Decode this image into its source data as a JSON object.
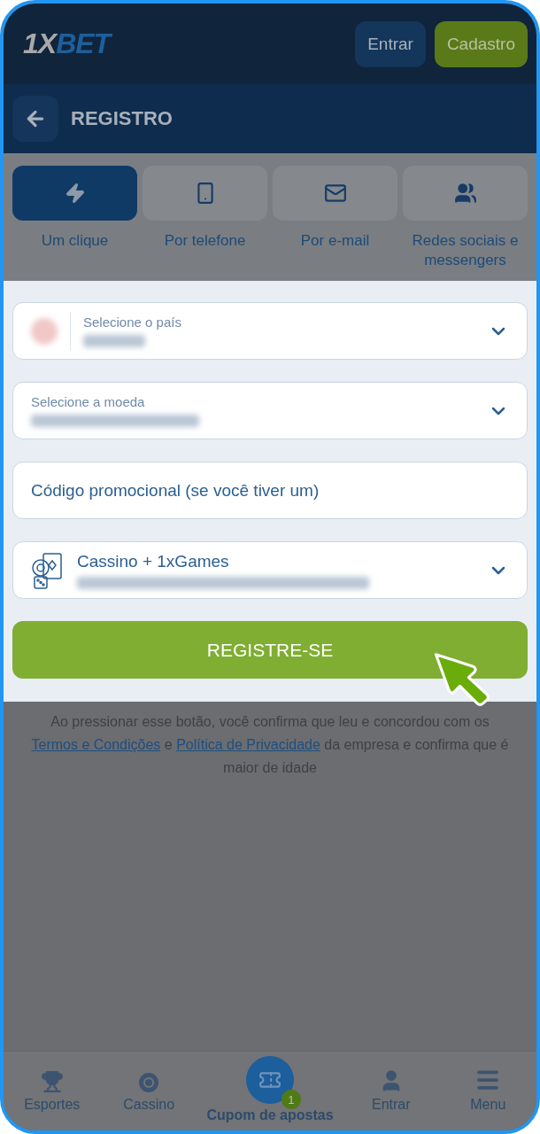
{
  "header": {
    "logo": {
      "part_1": "1X",
      "part_2": "BET"
    },
    "buttons": [
      {
        "label": "Entrar",
        "kind": "secondary"
      },
      {
        "label": "Cadastro",
        "kind": "primary"
      }
    ]
  },
  "page_title": "REGISTRO",
  "tabs": [
    {
      "label": "Um clique",
      "selected": true
    },
    {
      "label": "Por telefone",
      "selected": false
    },
    {
      "label": "Por e-mail",
      "selected": false
    },
    {
      "label": "Redes sociais e messengers",
      "selected": false
    }
  ],
  "fields": [
    {
      "kind": "flag_select",
      "label": "Selecione o país"
    },
    {
      "kind": "select",
      "label": "Selecione a moeda"
    },
    {
      "kind": "input",
      "placeholder": "Código promocional (se você tiver um)"
    },
    {
      "kind": "bonus",
      "title": "Cassino + 1xGames"
    }
  ],
  "submit": "REGISTRE-SE",
  "disclaimer": {
    "before": "Ao pressionar esse botão, você confirma que leu e concordou com os ",
    "terms_link": "Termos e Condições",
    "middle": " e ",
    "privacy_link": "Política de Privacidade",
    "after": " da empresa e confirma que é maior de idade"
  },
  "bottom_nav": [
    {
      "label": "Esportes",
      "selected": false
    },
    {
      "label": "Cassino",
      "selected": false
    },
    {
      "label": "Cupom de apostas",
      "selected": true,
      "badge": "1"
    },
    {
      "label": "Entrar",
      "selected": false
    },
    {
      "label": "Menu",
      "selected": false
    }
  ]
}
